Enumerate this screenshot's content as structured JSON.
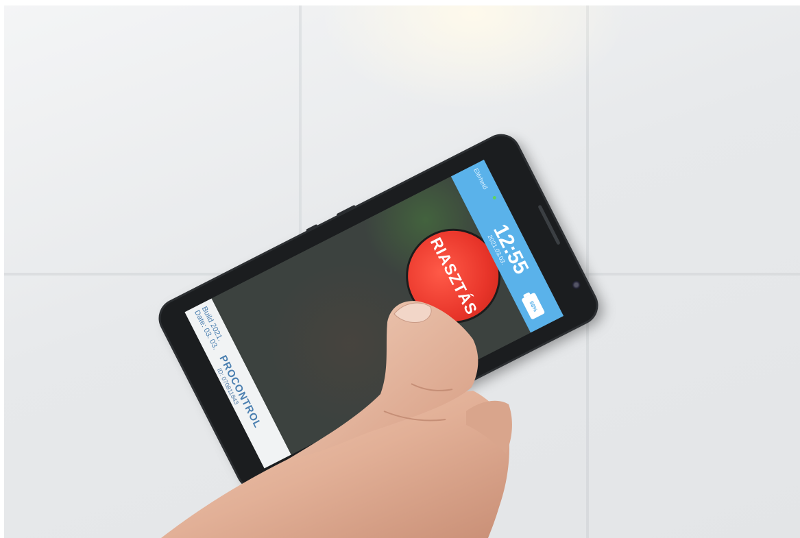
{
  "app": {
    "build_text": "Build 2021.",
    "date_text": "Date: 03. 03.",
    "brand": "PROCONTROL",
    "device_id": "ID: 070811843"
  },
  "main": {
    "alarm_button_label": "RIASZTÁS"
  },
  "status_bar": {
    "status_label": "Elérhető",
    "time": "12:55",
    "date": "2021.03.03.",
    "battery": "58%"
  },
  "colors": {
    "status_bar": "#5ab2ea",
    "alarm_button": "#e8352a",
    "brand_text": "#4a7fb0"
  },
  "icons": [
    "status-dot-icon",
    "battery-icon"
  ]
}
